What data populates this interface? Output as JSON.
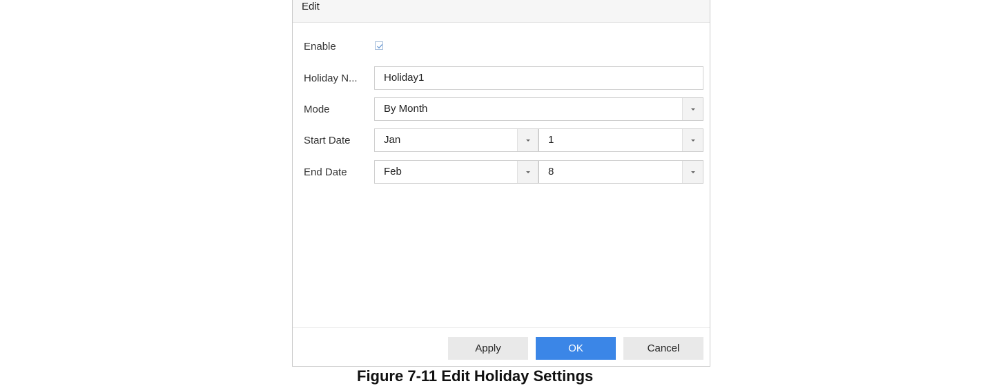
{
  "dialog": {
    "title": "Edit"
  },
  "form": {
    "enable": {
      "label": "Enable",
      "checked": true
    },
    "holiday_name": {
      "label": "Holiday N...",
      "value": "Holiday1"
    },
    "mode": {
      "label": "Mode",
      "value": "By Month"
    },
    "start_date": {
      "label": "Start Date",
      "month": "Jan",
      "day": "1"
    },
    "end_date": {
      "label": "End Date",
      "month": "Feb",
      "day": "8"
    }
  },
  "buttons": {
    "apply": "Apply",
    "ok": "OK",
    "cancel": "Cancel"
  },
  "caption": "Figure 7-11 Edit Holiday Settings",
  "colors": {
    "accent": "#3b86e7",
    "button_gray": "#e9e9e9",
    "header_bg": "#f6f6f6"
  },
  "icons": {
    "checkbox": "check-icon",
    "dropdown": "caret-down-icon"
  }
}
